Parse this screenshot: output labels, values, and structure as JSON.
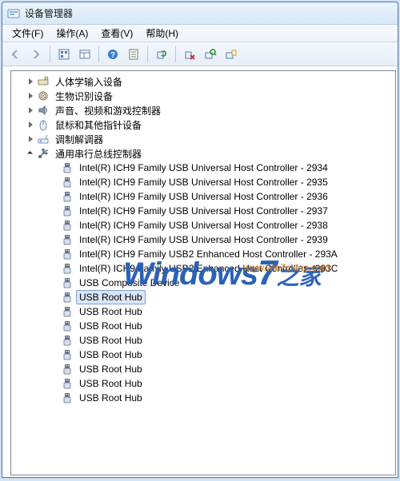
{
  "window": {
    "title": "设备管理器"
  },
  "menu": {
    "file": "文件(F)",
    "action": "操作(A)",
    "view": "查看(V)",
    "help": "帮助(H)"
  },
  "toolbar_icons": [
    "back",
    "forward",
    "sep",
    "show-hidden",
    "props-window",
    "sep",
    "help",
    "properties",
    "sep",
    "refresh",
    "sep",
    "uninstall",
    "scan-hardware",
    "update-driver"
  ],
  "categories": [
    {
      "label": "人体学输入设备",
      "icon": "hid"
    },
    {
      "label": "生物识别设备",
      "icon": "biometric"
    },
    {
      "label": "声音、视频和游戏控制器",
      "icon": "sound"
    },
    {
      "label": "鼠标和其他指针设备",
      "icon": "mouse"
    },
    {
      "label": "调制解调器",
      "icon": "modem"
    }
  ],
  "usb_category": {
    "label": "通用串行总线控制器"
  },
  "usb_devices": [
    {
      "label": "Intel(R) ICH9 Family USB Universal Host Controller - 2934"
    },
    {
      "label": "Intel(R) ICH9 Family USB Universal Host Controller - 2935"
    },
    {
      "label": "Intel(R) ICH9 Family USB Universal Host Controller - 2936"
    },
    {
      "label": "Intel(R) ICH9 Family USB Universal Host Controller - 2937"
    },
    {
      "label": "Intel(R) ICH9 Family USB Universal Host Controller - 2938"
    },
    {
      "label": "Intel(R) ICH9 Family USB Universal Host Controller - 2939"
    },
    {
      "label": "Intel(R) ICH9 Family USB2 Enhanced Host Controller - 293A"
    },
    {
      "label": "Intel(R) ICH9 Family USB2 Enhanced Host Controller - 293C"
    },
    {
      "label": "USB Composite Device"
    },
    {
      "label": "USB Root Hub",
      "selected": true
    },
    {
      "label": "USB Root Hub"
    },
    {
      "label": "USB Root Hub"
    },
    {
      "label": "USB Root Hub"
    },
    {
      "label": "USB Root Hub"
    },
    {
      "label": "USB Root Hub"
    },
    {
      "label": "USB Root Hub"
    },
    {
      "label": "USB Root Hub"
    }
  ],
  "watermark": {
    "url": "www.win7china.com",
    "text1": "Windows",
    "seven": "7",
    "text2": "之家"
  }
}
